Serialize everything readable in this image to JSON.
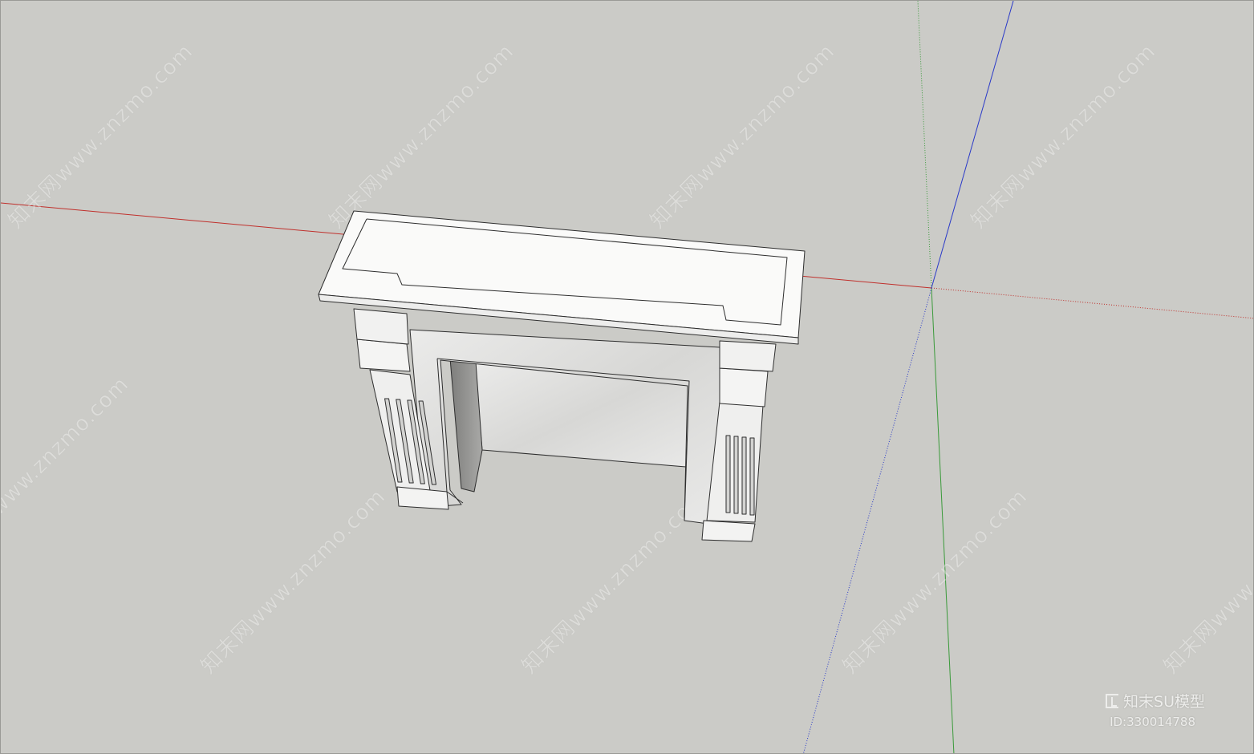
{
  "viewport": {
    "background_color": "#cbcbc7",
    "axis_colors": {
      "red_axis": "#c0302c",
      "green_axis": "#3a9a3a",
      "blue_axis": "#2a3ac8"
    }
  },
  "model": {
    "subject": "marble-fireplace-mantel",
    "marble_color": "#e6e6e4",
    "edge_color": "#2e2e2e"
  },
  "watermark": {
    "text": "知末网www.znzmo.com"
  },
  "brand": {
    "name": "知末SU模型",
    "id_label": "ID:330014788",
    "logo_icon": "znzmo-logo-icon"
  }
}
